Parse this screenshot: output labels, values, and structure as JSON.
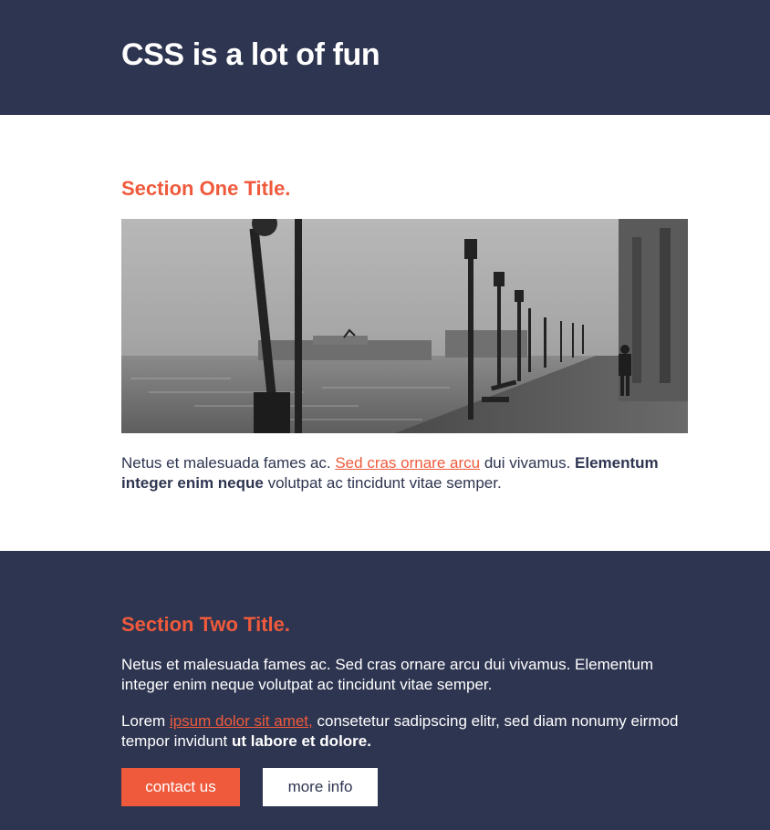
{
  "header": {
    "title": "CSS is a lot of fun"
  },
  "section_one": {
    "title": "Section One Title.",
    "paragraph": {
      "before_link": "Netus et malesuada fames ac. ",
      "link_text": "Sed cras ornare arcu",
      "after_link": " dui vivamus. ",
      "bold_text": "Elementum integer enim neque",
      "after_bold": " volutpat ac tincidunt vitae semper."
    }
  },
  "section_two": {
    "title": "Section Two Title.",
    "paragraph1": "Netus et malesuada fames ac. Sed cras ornare arcu dui vivamus. Elementum integer enim neque volutpat ac tincidunt vitae semper.",
    "paragraph2": {
      "before_link": "Lorem ",
      "link_text": "ipsum dolor sit amet,",
      "after_link": " consetetur sadipscing elitr, sed diam nonumy eirmod tempor invidunt ",
      "bold_text": "ut labore et dolore."
    },
    "buttons": {
      "primary_label": "contact us",
      "secondary_label": "more info"
    }
  },
  "colors": {
    "navy": "#2e3550",
    "accent": "#ef5a3c",
    "white": "#ffffff"
  }
}
